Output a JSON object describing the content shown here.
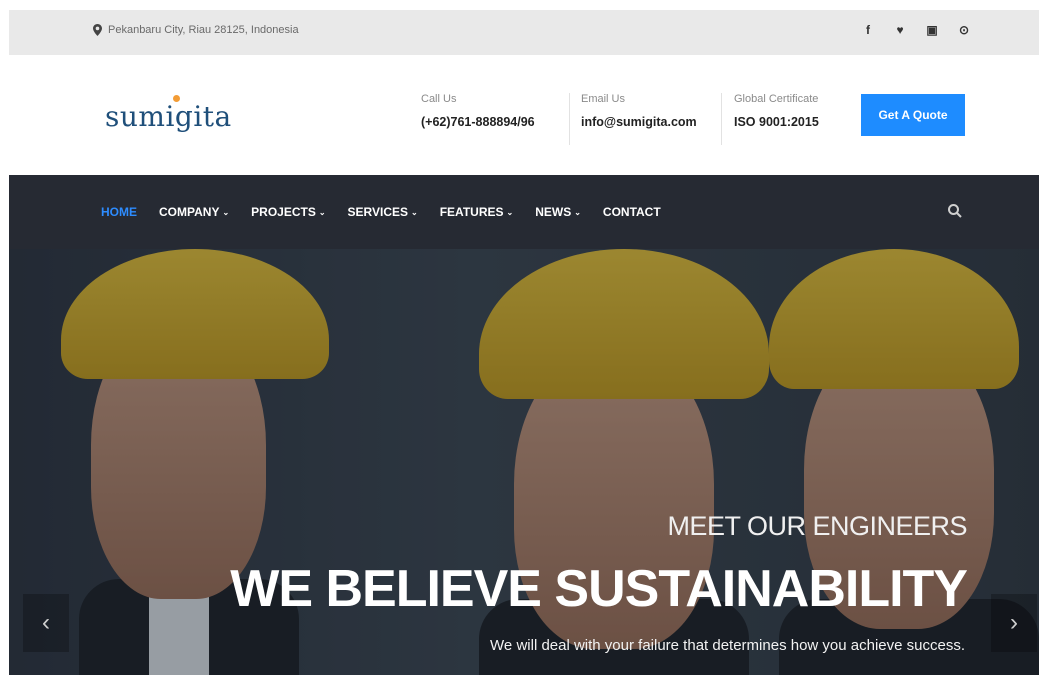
{
  "topbar": {
    "address": "Pekanbaru City, Riau 28125, Indonesia",
    "social": [
      {
        "icon": "facebook-icon",
        "glyph": "f"
      },
      {
        "icon": "twitter-icon",
        "glyph": "♥"
      },
      {
        "icon": "instagram-icon",
        "glyph": "▣"
      },
      {
        "icon": "github-icon",
        "glyph": "⊙"
      }
    ]
  },
  "header": {
    "logo": "sumigita",
    "call": {
      "label": "Call Us",
      "value": "(+62)761-888894/96"
    },
    "email": {
      "label": "Email Us",
      "value": "info@sumigita.com"
    },
    "cert": {
      "label": "Global Certificate",
      "value": "ISO 9001:2015"
    },
    "quote_button": "Get A Quote"
  },
  "nav": {
    "items": [
      {
        "label": "HOME",
        "active": true,
        "dropdown": false
      },
      {
        "label": "COMPANY",
        "active": false,
        "dropdown": true
      },
      {
        "label": "PROJECTS",
        "active": false,
        "dropdown": true
      },
      {
        "label": "SERVICES",
        "active": false,
        "dropdown": true
      },
      {
        "label": "FEATURES",
        "active": false,
        "dropdown": true
      },
      {
        "label": "NEWS",
        "active": false,
        "dropdown": true
      },
      {
        "label": "CONTACT",
        "active": false,
        "dropdown": false
      }
    ],
    "caret": "⌄"
  },
  "hero": {
    "subtitle": "MEET OUR ENGINEERS",
    "title": "WE BELIEVE SUSTAINABILITY",
    "description": "We will deal with your failure that determines how you achieve success.",
    "prev_glyph": "‹",
    "next_glyph": "›"
  },
  "colors": {
    "accent": "#1e8cff",
    "nav_bg": "#262a33",
    "topbar_bg": "#e9e9e9"
  }
}
